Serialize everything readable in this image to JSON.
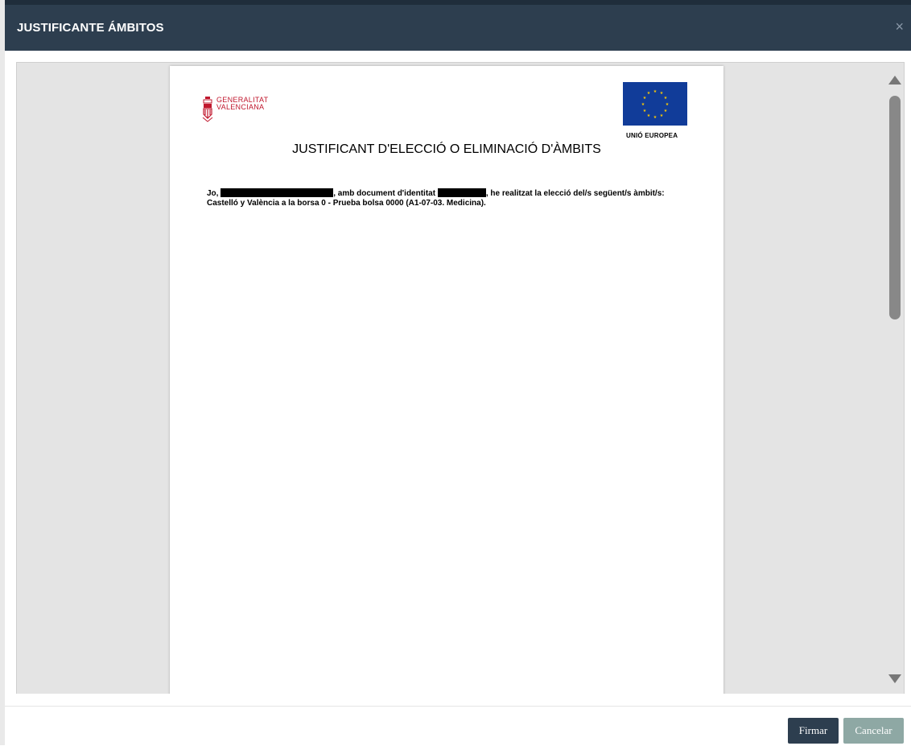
{
  "modal": {
    "title": "JUSTIFICANTE ÁMBITOS",
    "close_icon": "close-icon"
  },
  "document": {
    "logo_left": {
      "line1": "GENERALITAT",
      "line2": "VALENCIANA"
    },
    "logo_right_label": "UNIÓ EUROPEA",
    "title": "JUSTIFICANT D'ELECCIÓ O ELIMINACIÓ D'ÀMBITS",
    "body": {
      "part1": "Jo, ",
      "part2": ", amb document d'identitat ",
      "part3": ", he realitzat la elecció del/s següent/s àmbit/s: Castelló y València a la borsa 0 - Prueba bolsa 0000 (A1-07-03. Medicina)."
    }
  },
  "footer": {
    "sign_label": "Firmar",
    "cancel_label": "Cancelar"
  },
  "colors": {
    "header_bg": "#2d3e4f",
    "sign_button": "#2d3e4f",
    "cancel_button": "#8ea8a4",
    "logo_red": "#c0172d",
    "eu_blue": "#113c99",
    "eu_star": "#ffcc00"
  }
}
